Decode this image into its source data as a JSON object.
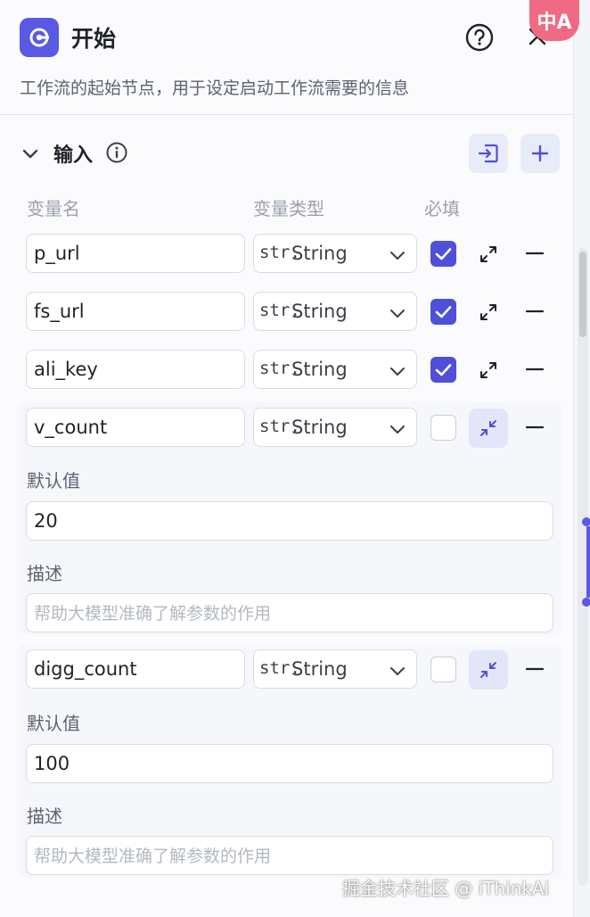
{
  "header": {
    "title": "开始",
    "subtitle": "工作流的起始节点，用于设定启动工作流需要的信息"
  },
  "translate_badge": "中A",
  "section": {
    "title": "输入"
  },
  "columns": {
    "name": "变量名",
    "type": "变量类型",
    "required": "必填"
  },
  "variables": [
    {
      "name": "p_url",
      "type_prefix": "str.",
      "type": "String",
      "required": true,
      "expanded": false
    },
    {
      "name": "fs_url",
      "type_prefix": "str.",
      "type": "String",
      "required": true,
      "expanded": false
    },
    {
      "name": "ali_key",
      "type_prefix": "str.",
      "type": "String",
      "required": true,
      "expanded": false
    },
    {
      "name": "v_count",
      "type_prefix": "str.",
      "type": "String",
      "required": false,
      "expanded": true,
      "default_label": "默认值",
      "default_value": "20",
      "desc_label": "描述",
      "desc_placeholder": "帮助大模型准确了解参数的作用"
    },
    {
      "name": "digg_count",
      "type_prefix": "str.",
      "type": "String",
      "required": false,
      "expanded": true,
      "default_label": "默认值",
      "default_value": "100",
      "desc_label": "描述",
      "desc_placeholder": "帮助大模型准确了解参数的作用"
    }
  ],
  "watermark": "掘金技术社区 @ iThinkAi",
  "colors": {
    "accent": "#5a59e4",
    "checkbox": "#4f4fd9",
    "button_bg": "#e8ebf8"
  }
}
